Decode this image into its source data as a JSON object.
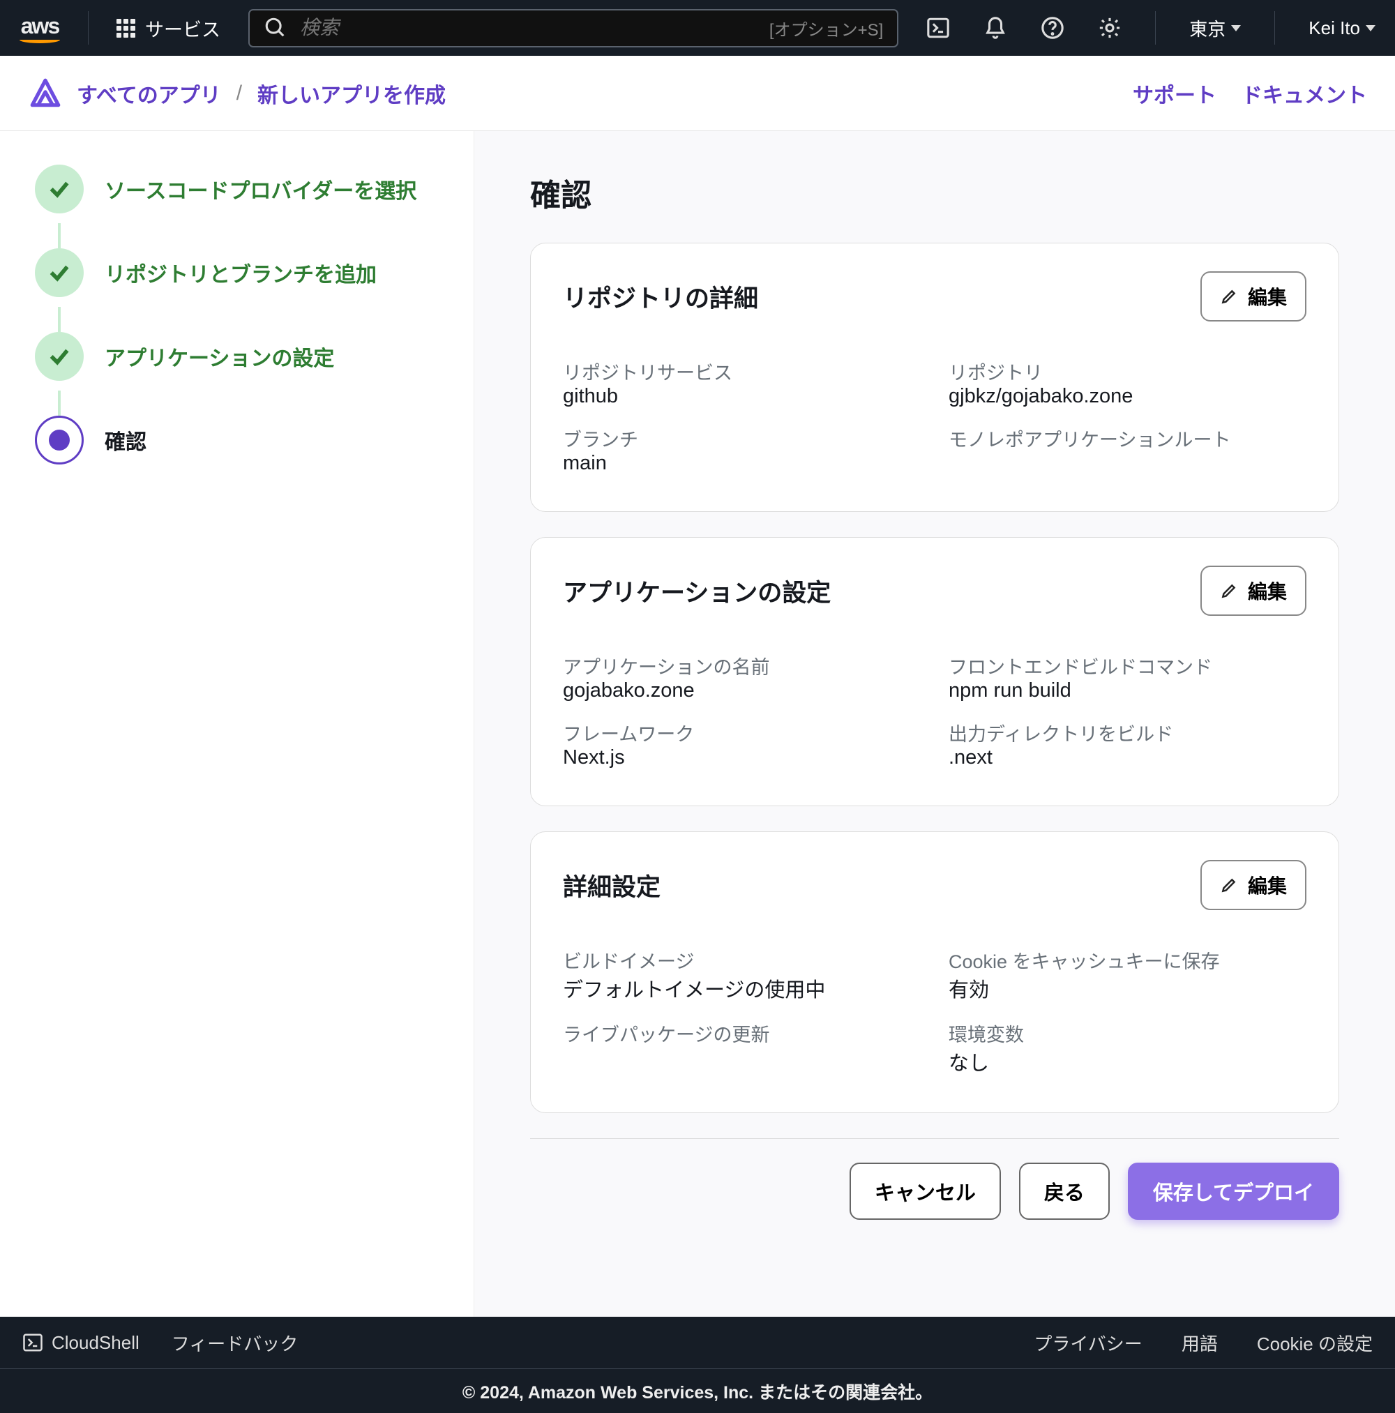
{
  "topbar": {
    "logo_text": "aws",
    "services_label": "サービス",
    "search_placeholder": "検索",
    "search_hint": "[オプション+S]",
    "region": "東京",
    "user": "Kei Ito"
  },
  "breadcrumb": {
    "all_apps": "すべてのアプリ",
    "create": "新しいアプリを作成",
    "support": "サポート",
    "docs": "ドキュメント"
  },
  "steps": {
    "s1": "ソースコードプロバイダーを選択",
    "s2": "リポジトリとブランチを追加",
    "s3": "アプリケーションの設定",
    "s4": "確認"
  },
  "page": {
    "title": "確認",
    "edit_label": "編集"
  },
  "card_repo": {
    "title": "リポジトリの詳細",
    "l_service": "リポジトリサービス",
    "v_service": "github",
    "l_repo": "リポジトリ",
    "v_repo": "gjbkz/gojabako.zone",
    "l_branch": "ブランチ",
    "v_branch": "main",
    "l_monoroot": "モノレポアプリケーションルート"
  },
  "card_app": {
    "title": "アプリケーションの設定",
    "l_name": "アプリケーションの名前",
    "v_name": "gojabako.zone",
    "l_build": "フロントエンドビルドコマンド",
    "v_build": "npm run build",
    "l_framework": "フレームワーク",
    "v_framework": "Next.js",
    "l_out": "出力ディレクトリをビルド",
    "v_out": ".next"
  },
  "card_adv": {
    "title": "詳細設定",
    "l_image": "ビルドイメージ",
    "v_image": "デフォルトイメージの使用中",
    "l_cookie": "Cookie をキャッシュキーに保存",
    "v_cookie": "有効",
    "l_live": "ライブパッケージの更新",
    "l_env": "環境変数",
    "v_env": "なし"
  },
  "actions": {
    "cancel": "キャンセル",
    "back": "戻る",
    "deploy": "保存してデプロイ"
  },
  "footer": {
    "cloudshell": "CloudShell",
    "feedback": "フィードバック",
    "privacy": "プライバシー",
    "terms": "用語",
    "cookie": "Cookie の設定",
    "copy": "© 2024, Amazon Web Services, Inc. またはその関連会社。"
  }
}
